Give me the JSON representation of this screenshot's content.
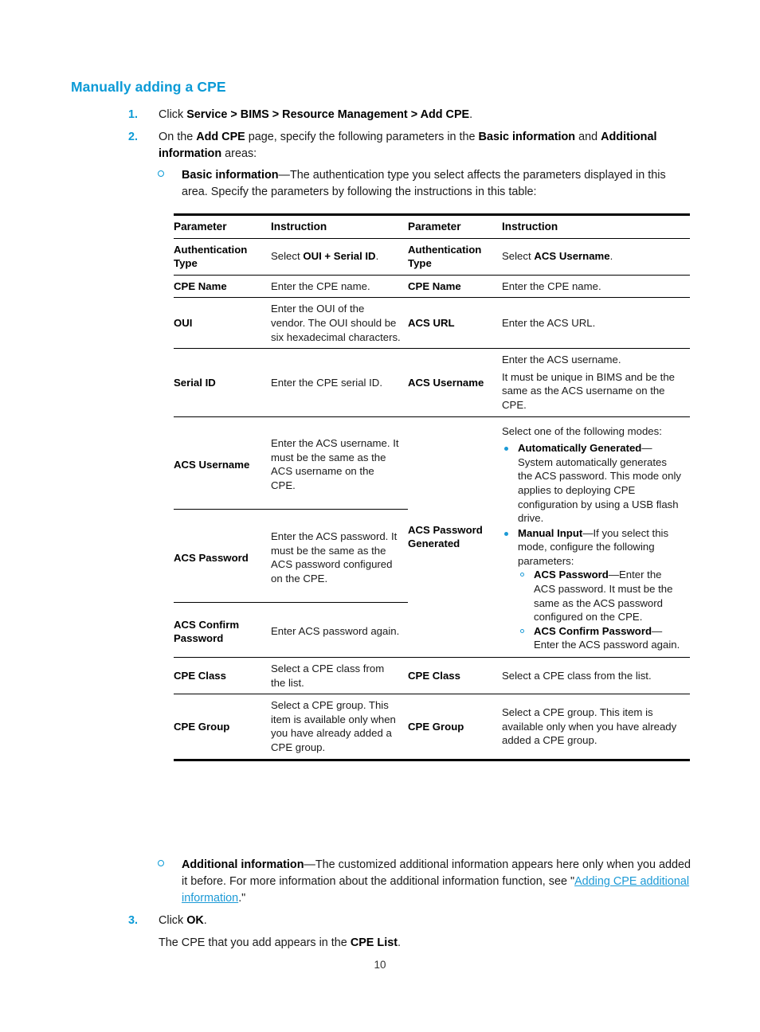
{
  "heading": "Manually adding a CPE",
  "colors": {
    "accent_blue": "#0b9ad6",
    "link_blue": "#1c9ad6",
    "text": "#1a1a1a"
  },
  "steps": {
    "step1": {
      "number": "1.",
      "text_before": "Click ",
      "bold_path": "Service > BIMS > Resource Management > Add CPE",
      "text_after": "."
    },
    "step2": {
      "number": "2.",
      "t1": "On the ",
      "b1": "Add CPE",
      "t2": " page, specify the following parameters in the ",
      "b2": "Basic information",
      "t3": " and ",
      "b3": "Additional information",
      "t4": " areas:"
    },
    "step3": {
      "number": "3.",
      "t1": "Click ",
      "b1": "OK",
      "t2": "."
    },
    "tail": {
      "t1": "The CPE that you add appears in the ",
      "b1": "CPE List",
      "t2": "."
    }
  },
  "substeps": {
    "basic": {
      "marker": "o",
      "b1": "Basic information",
      "t1": "—The authentication type you select affects the parameters displayed in this area. Specify the parameters by following the instructions in this table:"
    },
    "additional": {
      "marker": "o",
      "b1": "Additional information",
      "t1": "—The customized additional information appears here only when you added it before. For more information about the additional information function, see \"",
      "link": "Adding CPE additional information",
      "t2": ".\""
    }
  },
  "table": {
    "headers": [
      "Parameter",
      "Instruction",
      "Parameter",
      "Instruction"
    ],
    "rows": [
      {
        "id": "auth-type",
        "rule": "full",
        "c1": "Authentication Type",
        "c2_pre": "Select ",
        "c2_bold": "OUI + Serial ID",
        "c2_post": ".",
        "c3": "Authentication Type",
        "c4_pre": "Select ",
        "c4_bold": "ACS Username",
        "c4_post": "."
      },
      {
        "id": "cpe-name",
        "rule": "full",
        "c1": "CPE Name",
        "c2": "Enter the CPE name.",
        "c3": "CPE Name",
        "c4": "Enter the CPE name."
      },
      {
        "id": "oui",
        "rule": "full",
        "c1": "OUI",
        "c2": "Enter the OUI of the vendor. The OUI should be six hexadecimal characters.",
        "c3": "ACS URL",
        "c4": "Enter the ACS URL."
      },
      {
        "id": "serial-id",
        "rule": "full",
        "c1": "Serial ID",
        "c2": "Enter the CPE serial ID.",
        "c3": "ACS Username",
        "c4_p1": "Enter the ACS username.",
        "c4_p2": "It must be unique in BIMS and be the same as the ACS username on the CPE."
      },
      {
        "id": "acs-username",
        "rule": "full",
        "c1": "ACS Username",
        "c2": "Enter the ACS username. It must be the same as the ACS username on the CPE.",
        "c3": "ACS Password Generated",
        "c4_intro": "Select one of the following modes:",
        "c4_bullets": [
          {
            "bold": "Automatically Generated",
            "text": "—System automatically generates the ACS password. This mode only applies to deploying CPE configuration by using a USB flash drive."
          },
          {
            "bold": "Manual Input",
            "text": "—If you select this mode, configure the following parameters:",
            "subitems": [
              {
                "bold": "ACS Password",
                "text": "—Enter the ACS password. It must be the same as the ACS password configured on the CPE."
              },
              {
                "bold": "ACS Confirm Password",
                "text": "—Enter the ACS password again."
              }
            ]
          }
        ]
      },
      {
        "id": "acs-password",
        "rule": "left",
        "c1": "ACS Password",
        "c2": "Enter the ACS password. It must be the same as the ACS password configured on the CPE."
      },
      {
        "id": "acs-confirm-password",
        "rule": "left",
        "c1": "ACS Confirm Password",
        "c2": "Enter ACS password again."
      },
      {
        "id": "cpe-class",
        "rule": "full",
        "c1": "CPE Class",
        "c2": "Select a CPE class from the list.",
        "c3": "CPE Class",
        "c4": "Select a CPE class from the list."
      },
      {
        "id": "cpe-group",
        "rule": "full",
        "c1": "CPE Group",
        "c2": "Select a CPE group. This item is available only when you have already added a CPE group.",
        "c3": "CPE Group",
        "c4": "Select a CPE group. This item is available only when you have already added a CPE group."
      }
    ]
  },
  "page_number": "10"
}
